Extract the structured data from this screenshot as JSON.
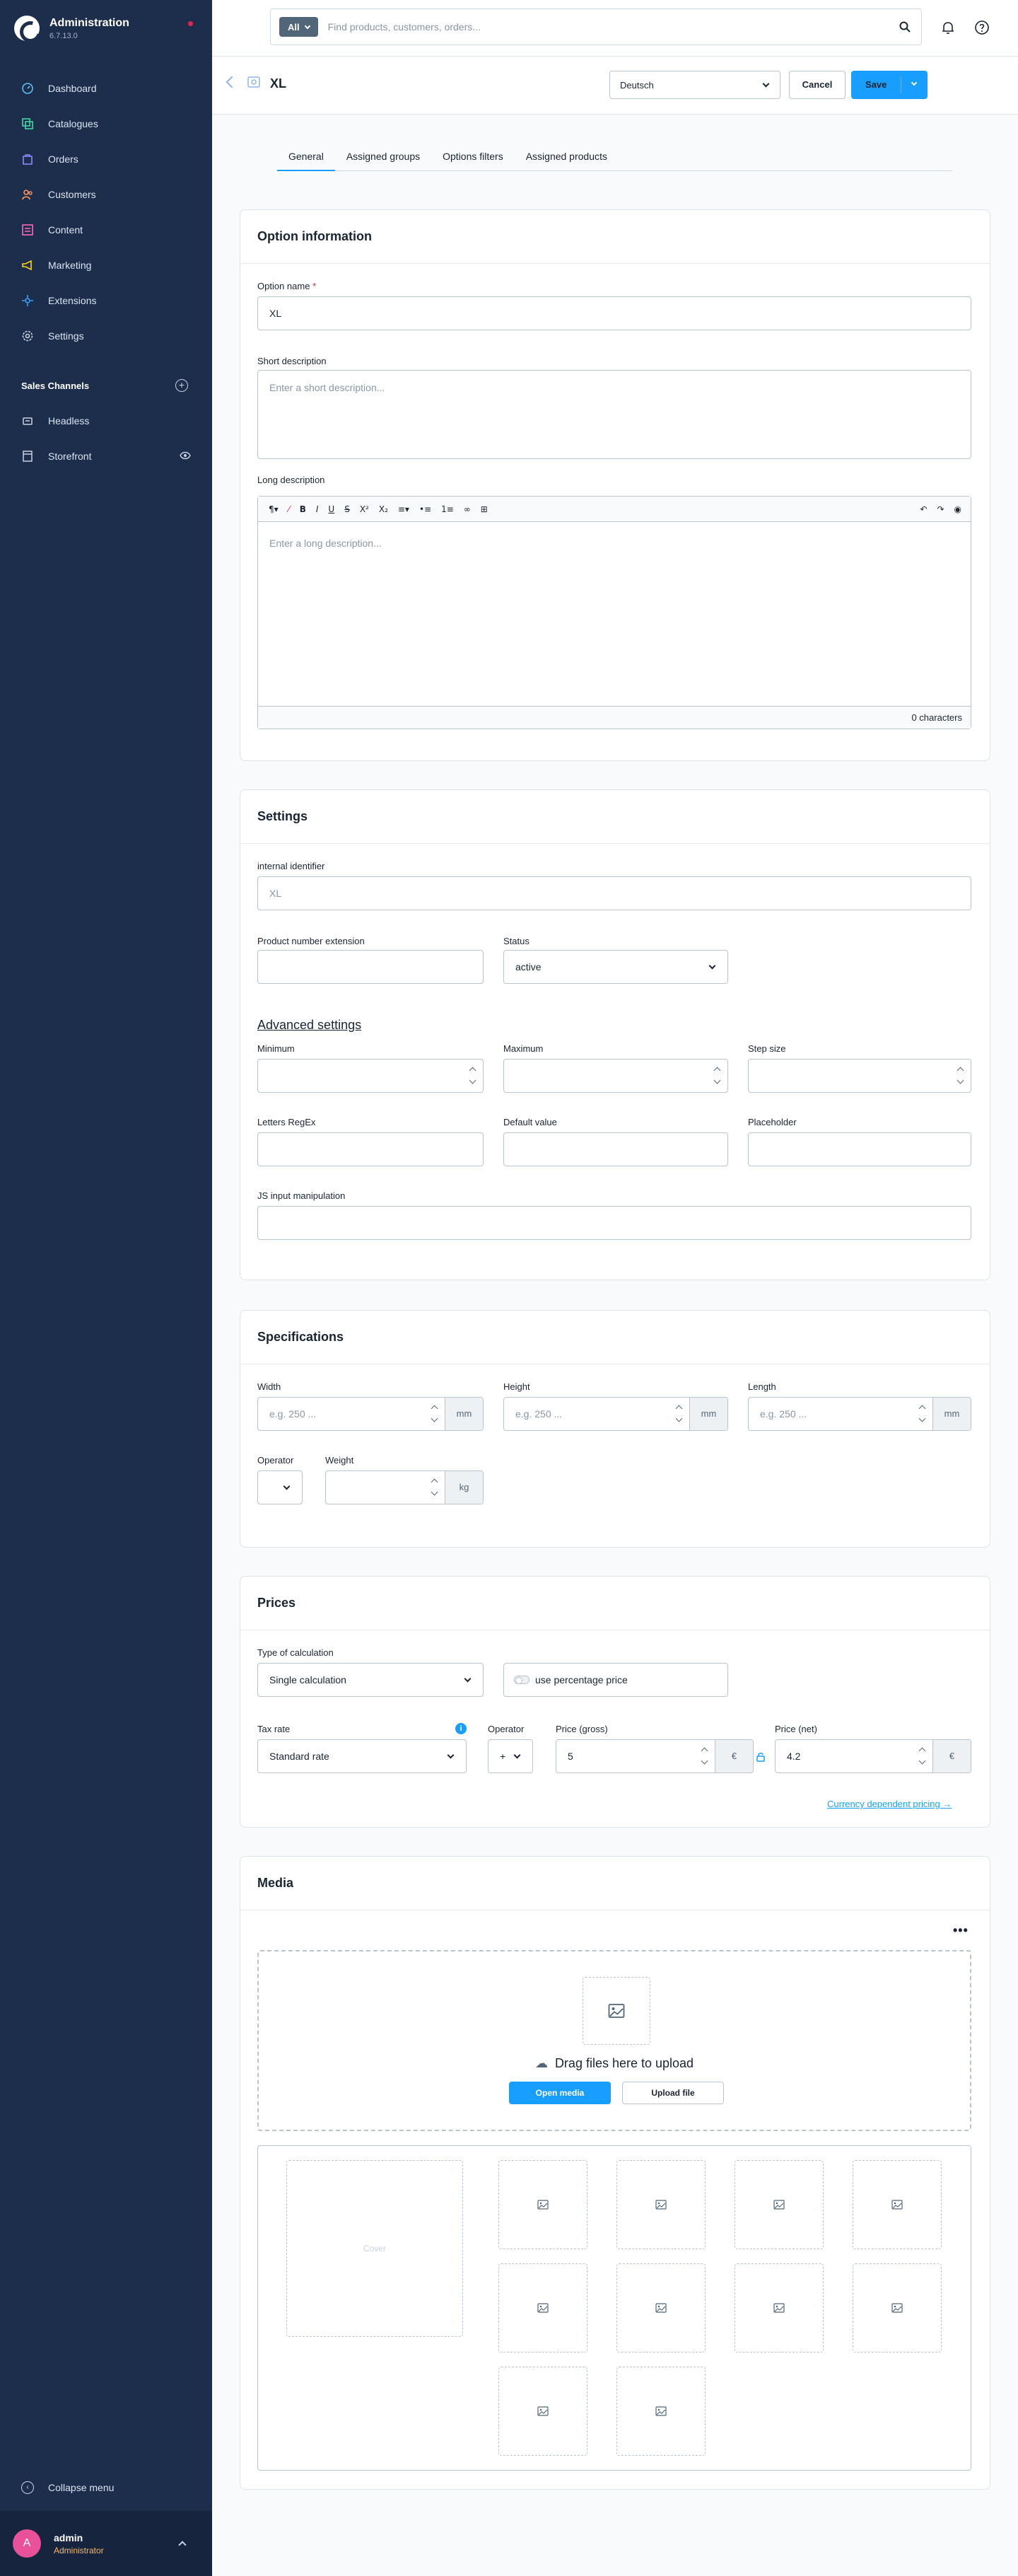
{
  "app": {
    "title": "Administration",
    "version": "6.7.13.0"
  },
  "nav": {
    "dashboard": "Dashboard",
    "catalogues": "Catalogues",
    "orders": "Orders",
    "customers": "Customers",
    "content": "Content",
    "marketing": "Marketing",
    "extensions": "Extensions",
    "settings": "Settings"
  },
  "sales_channels": {
    "title": "Sales Channels",
    "headless": "Headless",
    "storefront": "Storefront"
  },
  "collapse_label": "Collapse menu",
  "user": {
    "initial": "A",
    "name": "admin",
    "role": "Administrator"
  },
  "search": {
    "type": "All",
    "placeholder": "Find products, customers, orders..."
  },
  "smartbar": {
    "title": "XL",
    "language": "Deutsch",
    "cancel": "Cancel",
    "save": "Save"
  },
  "tabs": {
    "general": "General",
    "groups": "Assigned groups",
    "filters": "Options filters",
    "products": "Assigned products"
  },
  "option_info": {
    "title": "Option information",
    "name_label": "Option name",
    "name_required": "*",
    "name_value": "XL",
    "short_label": "Short description",
    "short_placeholder": "Enter a short description...",
    "long_label": "Long description",
    "long_placeholder": "Enter a long description...",
    "char_count": "0 characters"
  },
  "settings_card": {
    "title": "Settings",
    "internal_label": "internal identifier",
    "internal_placeholder": "XL",
    "ext_label": "Product number extension",
    "status_label": "Status",
    "status_value": "active",
    "advanced": "Advanced settings",
    "min_label": "Minimum",
    "max_label": "Maximum",
    "step_label": "Step size",
    "regex_label": "Letters RegEx",
    "default_label": "Default value",
    "placeholder_label": "Placeholder",
    "js_label": "JS input manipulation"
  },
  "specs": {
    "title": "Specifications",
    "width_label": "Width",
    "height_label": "Height",
    "length_label": "Length",
    "dim_placeholder": "e.g. 250 ...",
    "unit_mm": "mm",
    "operator_label": "Operator",
    "weight_label": "Weight",
    "unit_kg": "kg"
  },
  "prices": {
    "title": "Prices",
    "calc_label": "Type of calculation",
    "calc_value": "Single calculation",
    "percentage_label": "use percentage price",
    "tax_label": "Tax rate",
    "tax_value": "Standard rate",
    "operator_label": "Operator",
    "operator_value": "+",
    "gross_label": "Price (gross)",
    "gross_value": "5",
    "net_label": "Price (net)",
    "net_value": "4.2",
    "currency": "€",
    "currency_link": "Currency dependent pricing →"
  },
  "media": {
    "title": "Media",
    "menu": "•••",
    "drag_text": "Drag files here to upload",
    "open_media": "Open media",
    "upload_file": "Upload file",
    "cover": "Cover"
  }
}
